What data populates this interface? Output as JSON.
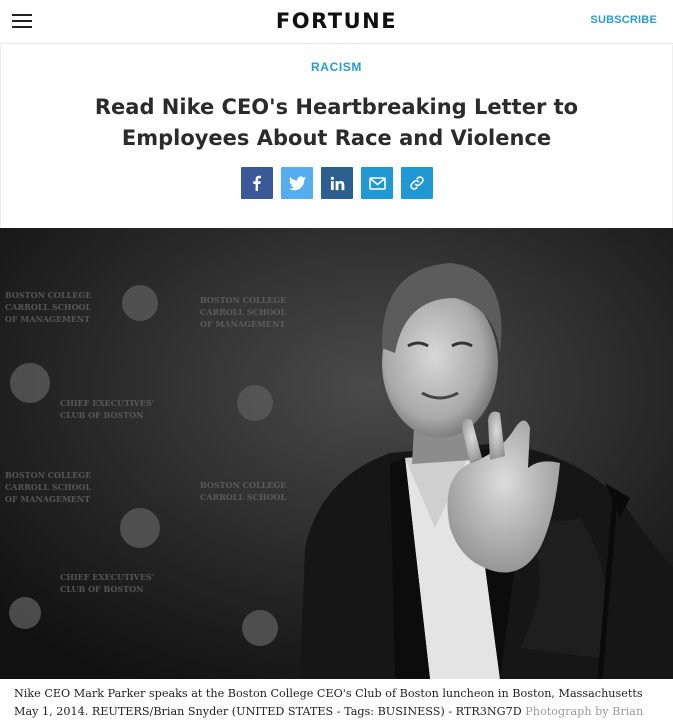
{
  "header": {
    "menu_icon": "hamburger-menu-icon",
    "logo": "FORTUNE",
    "subscribe_label": "SUBSCRIBE"
  },
  "article": {
    "section": "RACISM",
    "headline": "Read Nike CEO's Heartbreaking Letter to Employees About Race and Violence",
    "share_buttons": [
      {
        "icon": "facebook-icon",
        "color": "#3b5998"
      },
      {
        "icon": "twitter-icon",
        "color": "#55acee"
      },
      {
        "icon": "linkedin-icon",
        "color": "#2a5f8f"
      },
      {
        "icon": "email-icon",
        "color": "#1f98d3"
      },
      {
        "icon": "link-icon",
        "color": "#1f98d3"
      }
    ]
  },
  "photo": {
    "alt_icon": "portrait-photo",
    "backdrop_text": [
      "BOSTON COLLEGE",
      "CARROLL SCHOOL",
      "OF MANAGEMENT",
      "CHIEF EXECUTIVES'",
      "CLUB OF BOSTON"
    ]
  },
  "caption": {
    "text": "Nike CEO Mark Parker speaks at the Boston College CEO's Club of Boston luncheon in Boston, Massachusetts May 1, 2014. REUTERS/Brian Snyder (UNITED STATES - Tags: BUSINESS) - RTR3NG7D",
    "credit": "Photograph by Brian Snyder — Reuters"
  },
  "colors": {
    "accent": "#2a9bd8",
    "headline": "#2b2b2b"
  }
}
